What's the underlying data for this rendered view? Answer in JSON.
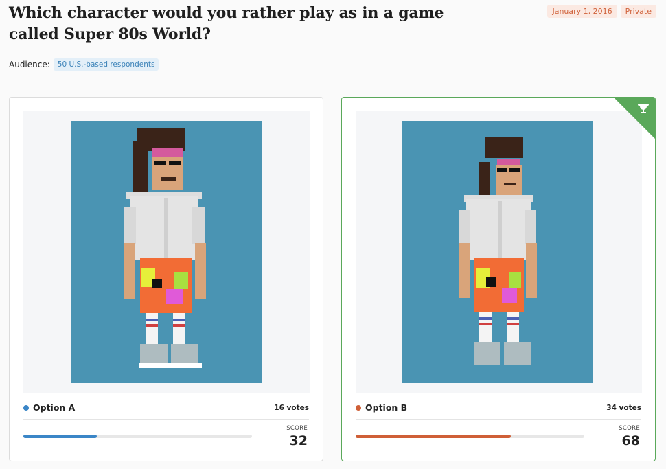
{
  "poll": {
    "title": "Which character would you rather play as in a game called Super 80s World?",
    "date": "January 1, 2016",
    "visibility": "Private",
    "audience_label": "Audience:",
    "audience_value": "50 U.S.-based respondents"
  },
  "options": [
    {
      "name": "Option A",
      "votes": "16 votes",
      "score_label": "SCORE",
      "score": "32",
      "progress": 0.32,
      "color": "#3b86c7"
    },
    {
      "name": "Option B",
      "votes": "34 votes",
      "score_label": "SCORE",
      "score": "68",
      "progress": 0.68,
      "color": "#cf5f37",
      "winner": true,
      "winner_icon": "trophy-icon"
    }
  ],
  "colors": {
    "winner_border": "#5aa85a",
    "image_bg": "#4a94b3"
  }
}
